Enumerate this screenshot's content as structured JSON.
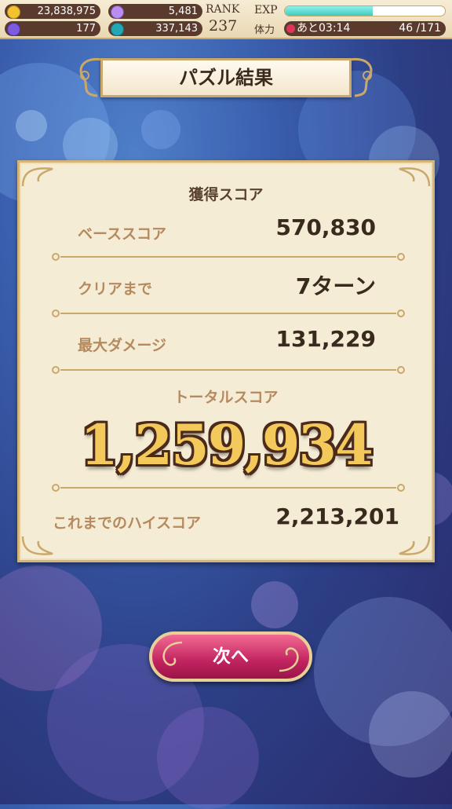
{
  "status": {
    "gold": "23,838,975",
    "magic_stone": "5,481",
    "crystal": "177",
    "orb": "337,143",
    "rank_label": "RANK",
    "rank_value": "237",
    "exp_label": "EXP",
    "exp_progress": 0.55,
    "stamina_label": "体力",
    "stamina_timer": "あと03:14",
    "stamina_count": "46 /171"
  },
  "title": "パズル結果",
  "result": {
    "section_title": "獲得スコア",
    "rows": [
      {
        "label": "ベーススコア",
        "value": "570,830"
      },
      {
        "label": "クリアまで",
        "value": "7ターン"
      },
      {
        "label": "最大ダメージ",
        "value": "131,229"
      }
    ],
    "total_label": "トータルスコア",
    "total_value": "1,259,934",
    "high_score_label": "これまでのハイスコア",
    "high_score_value": "2,213,201"
  },
  "next_button": "次へ",
  "colors": {
    "gold_icon": "#f2c230",
    "magic_icon": "#b98ef0",
    "crystal_icon": "#7b5ce0",
    "orb_icon": "#24a6b5",
    "stamina": "#e2345a",
    "exp_fill": "#3fcabf",
    "button": "#c22460"
  }
}
